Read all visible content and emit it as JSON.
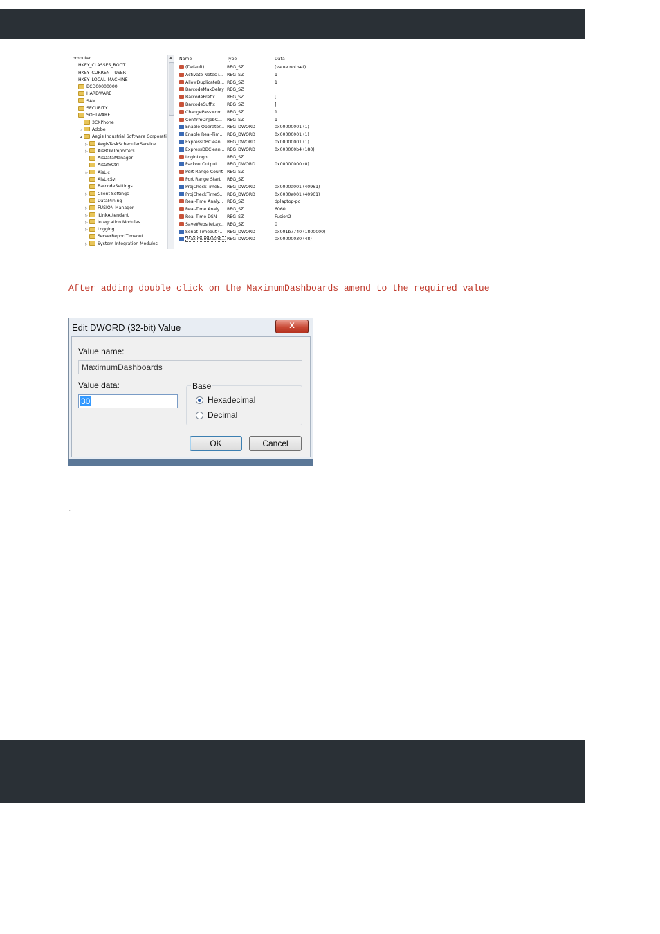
{
  "registry": {
    "tree": [
      {
        "label": "omputer",
        "indent": 0,
        "folder": false,
        "exp": ""
      },
      {
        "label": "HKEY_CLASSES_ROOT",
        "indent": 1,
        "folder": false,
        "exp": ""
      },
      {
        "label": "HKEY_CURRENT_USER",
        "indent": 1,
        "folder": false,
        "exp": ""
      },
      {
        "label": "HKEY_LOCAL_MACHINE",
        "indent": 1,
        "folder": false,
        "exp": ""
      },
      {
        "label": "BCD00000000",
        "indent": 1,
        "folder": true,
        "exp": ""
      },
      {
        "label": "HARDWARE",
        "indent": 1,
        "folder": true,
        "exp": ""
      },
      {
        "label": "SAM",
        "indent": 1,
        "folder": true,
        "exp": ""
      },
      {
        "label": "SECURITY",
        "indent": 1,
        "folder": true,
        "exp": ""
      },
      {
        "label": "SOFTWARE",
        "indent": 1,
        "folder": true,
        "exp": ""
      },
      {
        "label": "3CXPhone",
        "indent": 2,
        "folder": true,
        "exp": ""
      },
      {
        "label": "Adobe",
        "indent": 2,
        "folder": true,
        "exp": "▷"
      },
      {
        "label": "Aegis Industrial Software Corporation",
        "indent": 2,
        "folder": true,
        "exp": "◢"
      },
      {
        "label": "AegisTaskSchedulerService",
        "indent": 3,
        "folder": true,
        "exp": "▷"
      },
      {
        "label": "AisBOMImporters",
        "indent": 3,
        "folder": true,
        "exp": "▷"
      },
      {
        "label": "AisDataManager",
        "indent": 3,
        "folder": true,
        "exp": ""
      },
      {
        "label": "AisGfxCtrl",
        "indent": 3,
        "folder": true,
        "exp": ""
      },
      {
        "label": "AisLic",
        "indent": 3,
        "folder": true,
        "exp": "▷"
      },
      {
        "label": "AisLicSvr",
        "indent": 3,
        "folder": true,
        "exp": ""
      },
      {
        "label": "BarcodeSettings",
        "indent": 3,
        "folder": true,
        "exp": ""
      },
      {
        "label": "Client Settings",
        "indent": 3,
        "folder": true,
        "exp": "▷"
      },
      {
        "label": "DataMining",
        "indent": 3,
        "folder": true,
        "exp": ""
      },
      {
        "label": "FUSION Manager",
        "indent": 3,
        "folder": true,
        "exp": "▷"
      },
      {
        "label": "iLinkAttendant",
        "indent": 3,
        "folder": true,
        "exp": "▷"
      },
      {
        "label": "Integration Modules",
        "indent": 3,
        "folder": true,
        "exp": "▷"
      },
      {
        "label": "Logging",
        "indent": 3,
        "folder": true,
        "exp": "▷"
      },
      {
        "label": "ServerReportTimeout",
        "indent": 3,
        "folder": true,
        "exp": ""
      },
      {
        "label": "System Integration Modules",
        "indent": 3,
        "folder": true,
        "exp": "▷"
      }
    ],
    "columns": {
      "name": "Name",
      "type": "Type",
      "data": "Data"
    },
    "values": [
      {
        "name": "(Default)",
        "type": "REG_SZ",
        "data": "(value not set)",
        "icon": "sz"
      },
      {
        "name": "Activate Notes i...",
        "type": "REG_SZ",
        "data": "1",
        "icon": "sz"
      },
      {
        "name": "AllowDuplicateB...",
        "type": "REG_SZ",
        "data": "1",
        "icon": "sz"
      },
      {
        "name": "BarcodeMaxDelay",
        "type": "REG_SZ",
        "data": "",
        "icon": "sz"
      },
      {
        "name": "BarcodePrefix",
        "type": "REG_SZ",
        "data": "[",
        "icon": "sz"
      },
      {
        "name": "BarcodeSuffix",
        "type": "REG_SZ",
        "data": "]",
        "icon": "sz"
      },
      {
        "name": "ChangePassword",
        "type": "REG_SZ",
        "data": "1",
        "icon": "sz"
      },
      {
        "name": "ConfirmOnJobC...",
        "type": "REG_SZ",
        "data": "1",
        "icon": "sz"
      },
      {
        "name": "Enable Operator...",
        "type": "REG_DWORD",
        "data": "0x00000001 (1)",
        "icon": "dword"
      },
      {
        "name": "Enable Real-Tim...",
        "type": "REG_DWORD",
        "data": "0x00000001 (1)",
        "icon": "dword"
      },
      {
        "name": "ExpressDBClean...",
        "type": "REG_DWORD",
        "data": "0x00000001 (1)",
        "icon": "dword"
      },
      {
        "name": "ExpressDBClean...",
        "type": "REG_DWORD",
        "data": "0x000000b4 (180)",
        "icon": "dword"
      },
      {
        "name": "LoginLogo",
        "type": "REG_SZ",
        "data": "",
        "icon": "sz"
      },
      {
        "name": "PackoutOutput...",
        "type": "REG_DWORD",
        "data": "0x00000000 (0)",
        "icon": "dword"
      },
      {
        "name": "Port Range Count",
        "type": "REG_SZ",
        "data": "",
        "icon": "sz"
      },
      {
        "name": "Port Range Start",
        "type": "REG_SZ",
        "data": "",
        "icon": "sz"
      },
      {
        "name": "ProjCheckTimeE...",
        "type": "REG_DWORD",
        "data": "0x0000a001 (40961)",
        "icon": "dword"
      },
      {
        "name": "ProjCheckTimeS...",
        "type": "REG_DWORD",
        "data": "0x0000a001 (40961)",
        "icon": "dword"
      },
      {
        "name": "Real-Time Analy...",
        "type": "REG_SZ",
        "data": "dplaptop-pc",
        "icon": "sz"
      },
      {
        "name": "Real-Time Analy...",
        "type": "REG_SZ",
        "data": "6060",
        "icon": "sz"
      },
      {
        "name": "Real-Time DSN",
        "type": "REG_SZ",
        "data": "Fusion2",
        "icon": "sz"
      },
      {
        "name": "SaveWebsiteLay...",
        "type": "REG_SZ",
        "data": "0",
        "icon": "sz"
      },
      {
        "name": "Script Timeout (...",
        "type": "REG_DWORD",
        "data": "0x001b7740 (1800000)",
        "icon": "dword"
      },
      {
        "name": "MaximumDashb...",
        "type": "REG_DWORD",
        "data": "0x00000030 (48)",
        "icon": "dword",
        "selected": true
      }
    ]
  },
  "caption": "After adding double click on the MaximumDashboards amend to the required value",
  "dialog": {
    "title": "Edit DWORD (32-bit) Value",
    "close_label": "X",
    "value_name_label": "Value name:",
    "value_name": "MaximumDashboards",
    "value_data_label": "Value data:",
    "value_data": "30",
    "base_label": "Base",
    "hex_label": "Hexadecimal",
    "dec_label": "Decimal",
    "base_selected": "Hexadecimal",
    "ok_label": "OK",
    "cancel_label": "Cancel"
  },
  "trailing_dot": "."
}
